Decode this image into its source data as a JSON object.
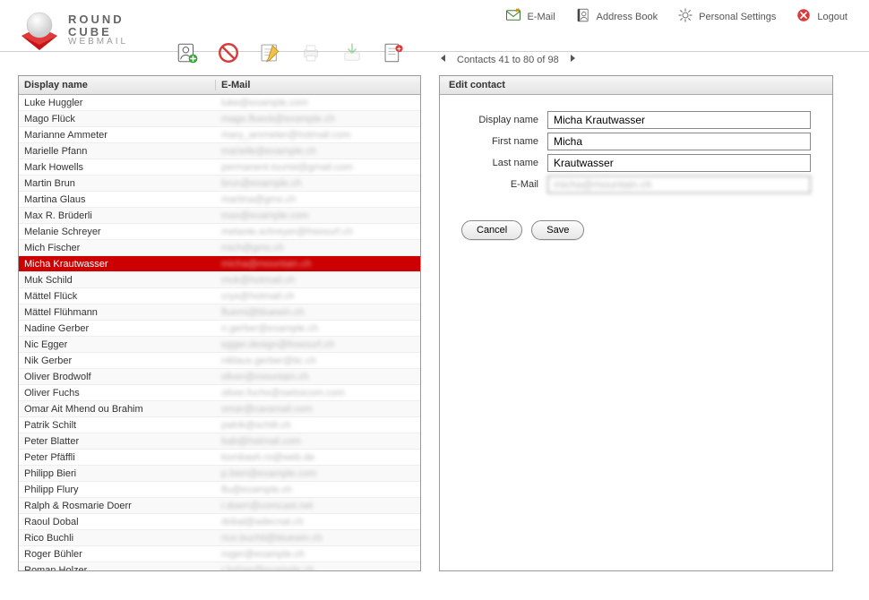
{
  "brand": {
    "line1": "ROUND",
    "line2": "CUBE",
    "line3": "WEBMAIL"
  },
  "topnav": {
    "email": "E-Mail",
    "addressbook": "Address Book",
    "settings": "Personal Settings",
    "logout": "Logout"
  },
  "pager": {
    "text": "Contacts 41 to 80 of 98"
  },
  "list": {
    "columns": {
      "name": "Display name",
      "email": "E-Mail"
    },
    "selected_index": 10,
    "rows": [
      {
        "name": "Luke Huggler",
        "email": "luke@example.com"
      },
      {
        "name": "Mago Flück",
        "email": "mago.flueck@example.ch"
      },
      {
        "name": "Marianne Ammeter",
        "email": "mary_ammeter@hotmail.com"
      },
      {
        "name": "Marielle Pfann",
        "email": "marielle@example.ch"
      },
      {
        "name": "Mark Howells",
        "email": "permanent.tourist@gmail.com"
      },
      {
        "name": "Martin Brun",
        "email": "brun@example.ch"
      },
      {
        "name": "Martina Glaus",
        "email": "martina@gms.ch"
      },
      {
        "name": "Max R. Brüderli",
        "email": "max@example.com"
      },
      {
        "name": "Melanie Schreyer",
        "email": "melanie.schreyer@freesurf.ch"
      },
      {
        "name": "Mich Fischer",
        "email": "mich@gms.ch"
      },
      {
        "name": "Micha Krautwasser",
        "email": "micha@mountain.ch"
      },
      {
        "name": "Muk Schild",
        "email": "muk@hotmail.ch"
      },
      {
        "name": "Mättel Flück",
        "email": "crys@hotmail.ch"
      },
      {
        "name": "Mättel Flühmann",
        "email": "fluemi@bluewin.ch"
      },
      {
        "name": "Nadine Gerber",
        "email": "n.gerber@example.ch"
      },
      {
        "name": "Nic Egger",
        "email": "egger.design@freesurf.ch"
      },
      {
        "name": "Nik Gerber",
        "email": "niklaus.gerber@tic.ch"
      },
      {
        "name": "Oliver Brodwolf",
        "email": "oliver@mountain.ch"
      },
      {
        "name": "Oliver Fuchs",
        "email": "oliver.fuchs@swisscom.com"
      },
      {
        "name": "Omar Ait Mhend ou Brahim",
        "email": "omar@caramail.com"
      },
      {
        "name": "Patrik Schilt",
        "email": "patrik@schilt.ch"
      },
      {
        "name": "Peter Blatter",
        "email": "bab@hotmail.com"
      },
      {
        "name": "Peter Pfäffli",
        "email": "kombash.ro@web.de"
      },
      {
        "name": "Philipp Bieri",
        "email": "p.bieri@example.com"
      },
      {
        "name": "Philipp Flury",
        "email": "flu@example.ch"
      },
      {
        "name": "Ralph & Rosmarie Doerr",
        "email": "r.doerr@comcast.net"
      },
      {
        "name": "Raoul Dobal",
        "email": "dobal@adecnat.ch"
      },
      {
        "name": "Rico Buchli",
        "email": "rico.buchli@bluewin.ch"
      },
      {
        "name": "Roger Bühler",
        "email": "roger@example.ch"
      },
      {
        "name": "Roman Holzer",
        "email": "r.holzer@example.ch"
      }
    ]
  },
  "edit": {
    "title": "Edit contact",
    "labels": {
      "display_name": "Display name",
      "first_name": "First name",
      "last_name": "Last name",
      "email": "E-Mail"
    },
    "values": {
      "display_name": "Micha Krautwasser",
      "first_name": "Micha",
      "last_name": "Krautwasser",
      "email": "micha@mountain.ch"
    },
    "buttons": {
      "cancel": "Cancel",
      "save": "Save"
    }
  }
}
